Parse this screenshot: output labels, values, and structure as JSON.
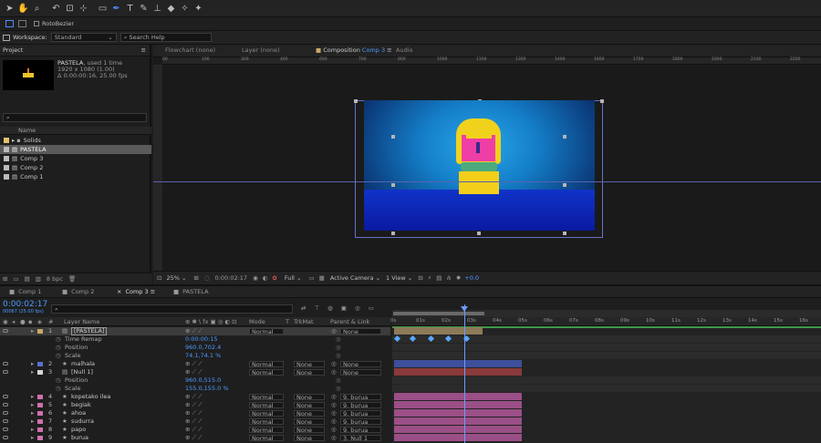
{
  "toolbar": {
    "tools": [
      "selection-tool",
      "hand-tool",
      "zoom-tool",
      "rotate-tool",
      "camera-tool",
      "pan-behind-tool",
      "rectangle-tool",
      "pen-tool",
      "type-tool",
      "brush-tool",
      "clone-stamp-tool",
      "eraser-tool",
      "roto-brush-tool",
      "puppet-pin-tool"
    ],
    "rotobezier_label": "RotoBezier"
  },
  "workspace": {
    "label": "Workspace:",
    "value": "Standard",
    "search_placeholder": "Search Help"
  },
  "project": {
    "tab": "Project",
    "item_name": "PASTELA",
    "used": ", used 1 time",
    "dims": "1920 x 1080 (1.00)",
    "duration": "Δ 0:00:00:16, 25.00 fps",
    "column_name": "Name",
    "items": [
      {
        "label": "Solids",
        "type": "folder"
      },
      {
        "label": "PASTELA",
        "type": "comp",
        "selected": true
      },
      {
        "label": "Comp 3",
        "type": "comp"
      },
      {
        "label": "Comp 2",
        "type": "comp"
      },
      {
        "label": "Comp 1",
        "type": "comp"
      }
    ],
    "bpc": "8 bpc"
  },
  "viewer": {
    "tabs": {
      "flowchart": "Flowchart (none)",
      "layer": "Layer (none)",
      "composition": "Composition",
      "composition_name": "Comp 3",
      "audio": "Audio"
    },
    "ruler_labels": [
      "00",
      "100",
      "300",
      "400",
      "600",
      "700",
      "800",
      "1000",
      "1100",
      "1300",
      "1400",
      "1600",
      "1700",
      "1800",
      "2000",
      "2100",
      "2200"
    ],
    "zoom": "25%",
    "timecode": "0:00:02:17",
    "resolution": "Full",
    "camera": "Active Camera",
    "views": "1 View",
    "exposure": "+0.0"
  },
  "timeline": {
    "tabs": [
      "Comp 1",
      "Comp 2",
      "Comp 3",
      "PASTELA"
    ],
    "active_tab": "Comp 3",
    "timecode": "0:00:02:17",
    "timecode_sub": "00067 (25.00 fps)",
    "columns": {
      "layer_name": "Layer Name",
      "mode": "Mode",
      "trkmat": "TrkMat",
      "parent": "Parent & Link"
    },
    "ruler": [
      "0s",
      "01s",
      "02s",
      "03s",
      "04s",
      "05s",
      "06s",
      "07s",
      "08s",
      "09s",
      "10s",
      "11s",
      "12s",
      "13s",
      "14s",
      "15s",
      "16s"
    ],
    "rows": [
      {
        "kind": "layer",
        "num": "1",
        "name": "[PASTELA]",
        "mode": "Normal",
        "trk": "",
        "parent": "None",
        "color": "#c8a86a",
        "selected": true
      },
      {
        "kind": "prop",
        "name": "Time Remap",
        "value": "0:00:00:15"
      },
      {
        "kind": "prop",
        "name": "Position",
        "value": "960.0,702.4"
      },
      {
        "kind": "prop",
        "name": "Scale",
        "value": "74.1,74.1 %"
      },
      {
        "kind": "layer",
        "num": "2",
        "name": "malhala",
        "mode": "Normal",
        "trk": "None",
        "parent": "None",
        "color": "#5a6fd0"
      },
      {
        "kind": "layer",
        "num": "3",
        "name": "[Null 1]",
        "mode": "Normal",
        "trk": "None",
        "parent": "None",
        "color": "#d8d8d8"
      },
      {
        "kind": "prop",
        "name": "Position",
        "value": "960.0,515.0"
      },
      {
        "kind": "prop",
        "name": "Scale",
        "value": "155.0,155.0 %"
      },
      {
        "kind": "layer",
        "num": "4",
        "name": "kopetako ilea",
        "mode": "Normal",
        "trk": "None",
        "parent": "9. burua",
        "color": "#d070b0"
      },
      {
        "kind": "layer",
        "num": "5",
        "name": "begiak",
        "mode": "Normal",
        "trk": "None",
        "parent": "9. burua",
        "color": "#d070b0"
      },
      {
        "kind": "layer",
        "num": "6",
        "name": "ahoa",
        "mode": "Normal",
        "trk": "None",
        "parent": "9. burua",
        "color": "#d070b0"
      },
      {
        "kind": "layer",
        "num": "7",
        "name": "sudurra",
        "mode": "Normal",
        "trk": "None",
        "parent": "9. burua",
        "color": "#d070b0"
      },
      {
        "kind": "layer",
        "num": "8",
        "name": "papo",
        "mode": "Normal",
        "trk": "None",
        "parent": "9. burua",
        "color": "#d070b0"
      },
      {
        "kind": "layer",
        "num": "9",
        "name": "burua",
        "mode": "Normal",
        "trk": "None",
        "parent": "3. Null 1",
        "color": "#d070b0"
      }
    ],
    "colors": {
      "accent": "#4d9bff",
      "pastela_bar": "#8c7a58",
      "malhala_bar": "#3d4f9a",
      "null_bar": "#8a3a3a",
      "pink_bar": "#9a4f86"
    }
  }
}
